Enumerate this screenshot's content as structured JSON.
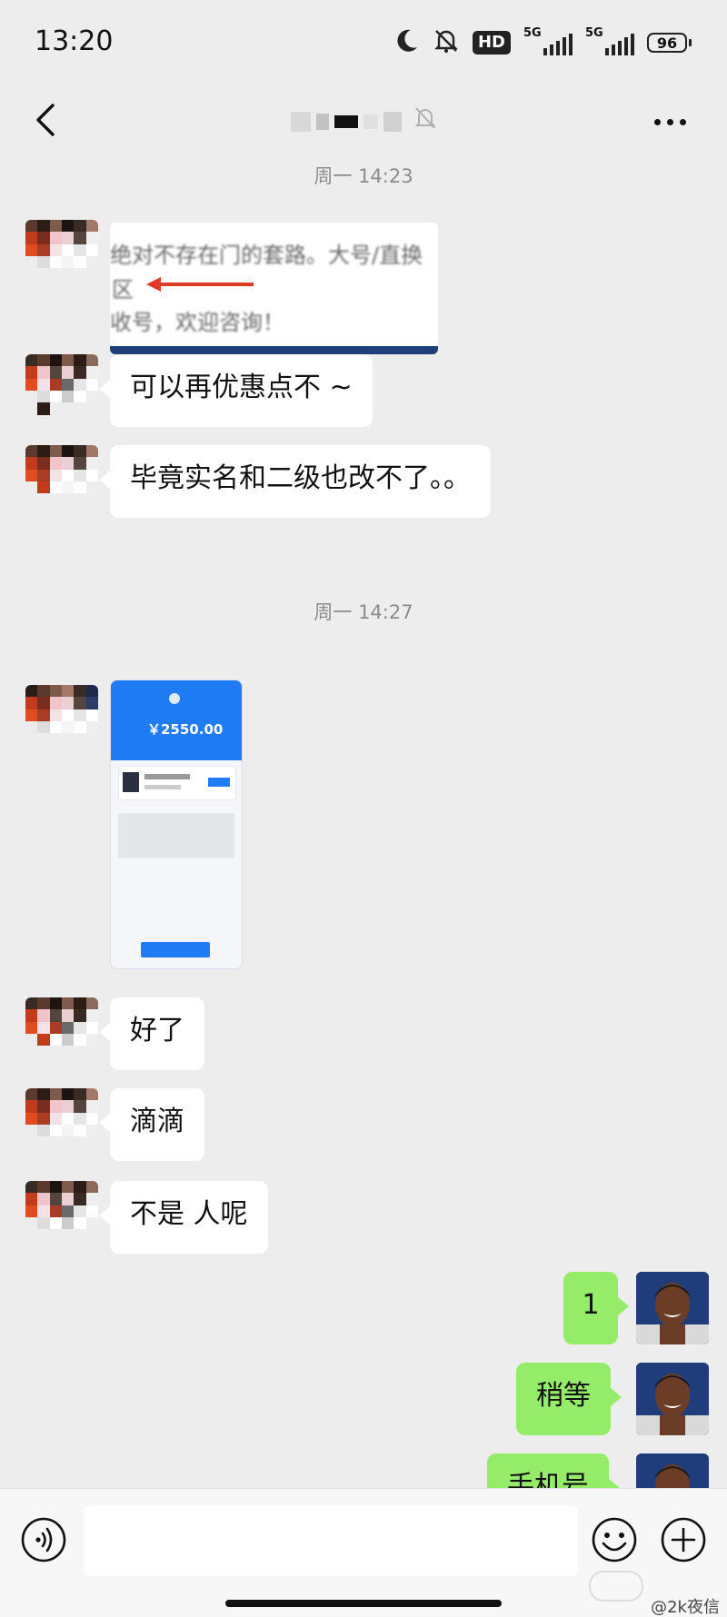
{
  "status_bar": {
    "time": "13:20",
    "hd_label": "HD",
    "network_1": "5G",
    "network_2": "5G",
    "battery": "96"
  },
  "nav": {
    "title": "",
    "back_icon": "chevron-left-icon",
    "mute_icon": "bell-off-icon",
    "more_icon": "more-dots-icon"
  },
  "timestamps": [
    "周一 14:23",
    "周一 14:27"
  ],
  "messages": [
    {
      "side": "left",
      "type": "image",
      "lines": [
        "绝对不存在门的套路。大号/直换",
        "区",
        "收号，欢迎咨询！"
      ]
    },
    {
      "side": "left",
      "type": "text",
      "text": "可以再优惠点不 ~"
    },
    {
      "side": "left",
      "type": "text",
      "text": "毕竟实名和二级也改不了。。"
    },
    {
      "side": "left",
      "type": "image",
      "amount": "￥2550.00"
    },
    {
      "side": "left",
      "type": "text",
      "text": "好了"
    },
    {
      "side": "left",
      "type": "text",
      "text": "滴滴"
    },
    {
      "side": "left",
      "type": "text",
      "text": "不是 人呢"
    },
    {
      "side": "right",
      "type": "text",
      "text": "1"
    },
    {
      "side": "right",
      "type": "text",
      "text": "稍等"
    },
    {
      "side": "right",
      "type": "text",
      "text": "手机号"
    }
  ],
  "input_bar": {
    "placeholder": "",
    "voice_icon": "voice-icon",
    "emoji_icon": "emoji-icon",
    "plus_icon": "plus-icon"
  },
  "watermark": "@2k夜信",
  "colors": {
    "background": "#ededed",
    "bubble_in": "#ffffff",
    "bubble_out": "#95ec69",
    "accent_blue": "#1f7cf5"
  }
}
